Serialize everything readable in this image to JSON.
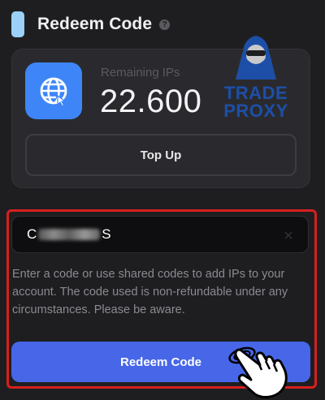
{
  "header": {
    "title": "Redeem Code",
    "help_icon": "?"
  },
  "balance": {
    "label": "Remaining IPs",
    "value": "22.600",
    "icon": "globe-icon",
    "topup_label": "Top Up"
  },
  "watermark": {
    "line1": "TRADE",
    "line2": "PROXY"
  },
  "redeem": {
    "code_prefix": "C",
    "code_suffix": "S",
    "helper_text": "Enter a code or use shared codes to add IPs to your account. The code used is non-refundable under any circumstances. Please be aware.",
    "button_label": "Redeem Code"
  },
  "colors": {
    "background": "#1e1e21",
    "card": "#2a2a2e",
    "accent_blue": "#3e86f7",
    "button_blue": "#4767e8",
    "highlight_red": "#d6201e",
    "title_bar": "#9bd0f7"
  }
}
